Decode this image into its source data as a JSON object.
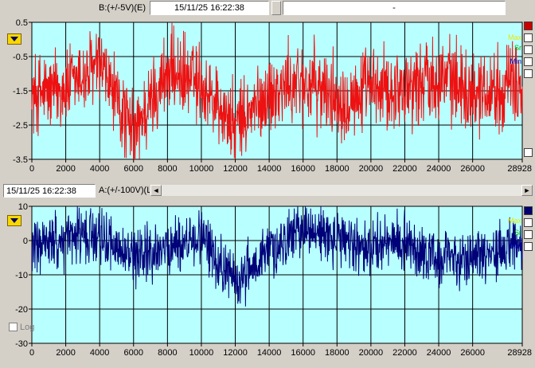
{
  "top_bar": {
    "channel_label": "B:(+/-5V)(E)",
    "timestamp": "15/11/25  16:22:38",
    "info": "-"
  },
  "middle_bar": {
    "timestamp": "15/11/25 16:22:38",
    "channel_label": "A:(+/-100V)(L"
  },
  "top_chart": {
    "legend": {
      "max": "Max",
      "sr": "Sr",
      "min": "Min"
    },
    "color": "#ee1111",
    "background": "#b8ffff"
  },
  "bottom_chart": {
    "legend": {
      "max": "Max",
      "sr": "Sr",
      "min": "Min"
    },
    "log_label": "Log",
    "color": "#000078",
    "background": "#b8ffff"
  },
  "chart_data": [
    {
      "type": "line",
      "title": "",
      "series": [
        {
          "name": "B:(+/-5V)(E)",
          "color": "#ee1111"
        }
      ],
      "xlim": [
        0,
        28928
      ],
      "ylim": [
        -3.5,
        0.5
      ],
      "x_ticks": [
        0,
        2000,
        4000,
        6000,
        8000,
        10000,
        12000,
        14000,
        16000,
        18000,
        20000,
        22000,
        24000,
        26000,
        28928
      ],
      "y_ticks": [
        0.5,
        -0.5,
        -1.5,
        -2.5,
        -3.5
      ],
      "grid": true,
      "sampled_x": [
        0,
        2000,
        4000,
        6000,
        8000,
        10000,
        12000,
        14000,
        16000,
        18000,
        20000,
        22000,
        24000,
        26000,
        28928
      ],
      "sampled_y": [
        -1.6,
        -1.4,
        -0.8,
        -2.8,
        -0.9,
        -1.3,
        -2.6,
        -1.6,
        -1.2,
        -1.7,
        -1.5,
        -1.4,
        -1.0,
        -1.5,
        -1.3
      ]
    },
    {
      "type": "line",
      "title": "",
      "series": [
        {
          "name": "A:(+/-100V)",
          "color": "#000078"
        }
      ],
      "xlim": [
        0,
        28928
      ],
      "ylim": [
        -30,
        10
      ],
      "x_ticks": [
        0,
        2000,
        4000,
        6000,
        8000,
        10000,
        12000,
        14000,
        16000,
        18000,
        20000,
        22000,
        24000,
        26000,
        28928
      ],
      "y_ticks": [
        10,
        0,
        -10,
        -20,
        -30
      ],
      "grid": true,
      "sampled_x": [
        0,
        2000,
        4000,
        6000,
        8000,
        10000,
        12000,
        14000,
        16000,
        18000,
        20000,
        22000,
        24000,
        26000,
        28928
      ],
      "sampled_y": [
        -2,
        0,
        2,
        -6,
        -2,
        1,
        -12,
        -3,
        4,
        0,
        -2,
        0,
        -6,
        -4,
        -2
      ]
    }
  ]
}
